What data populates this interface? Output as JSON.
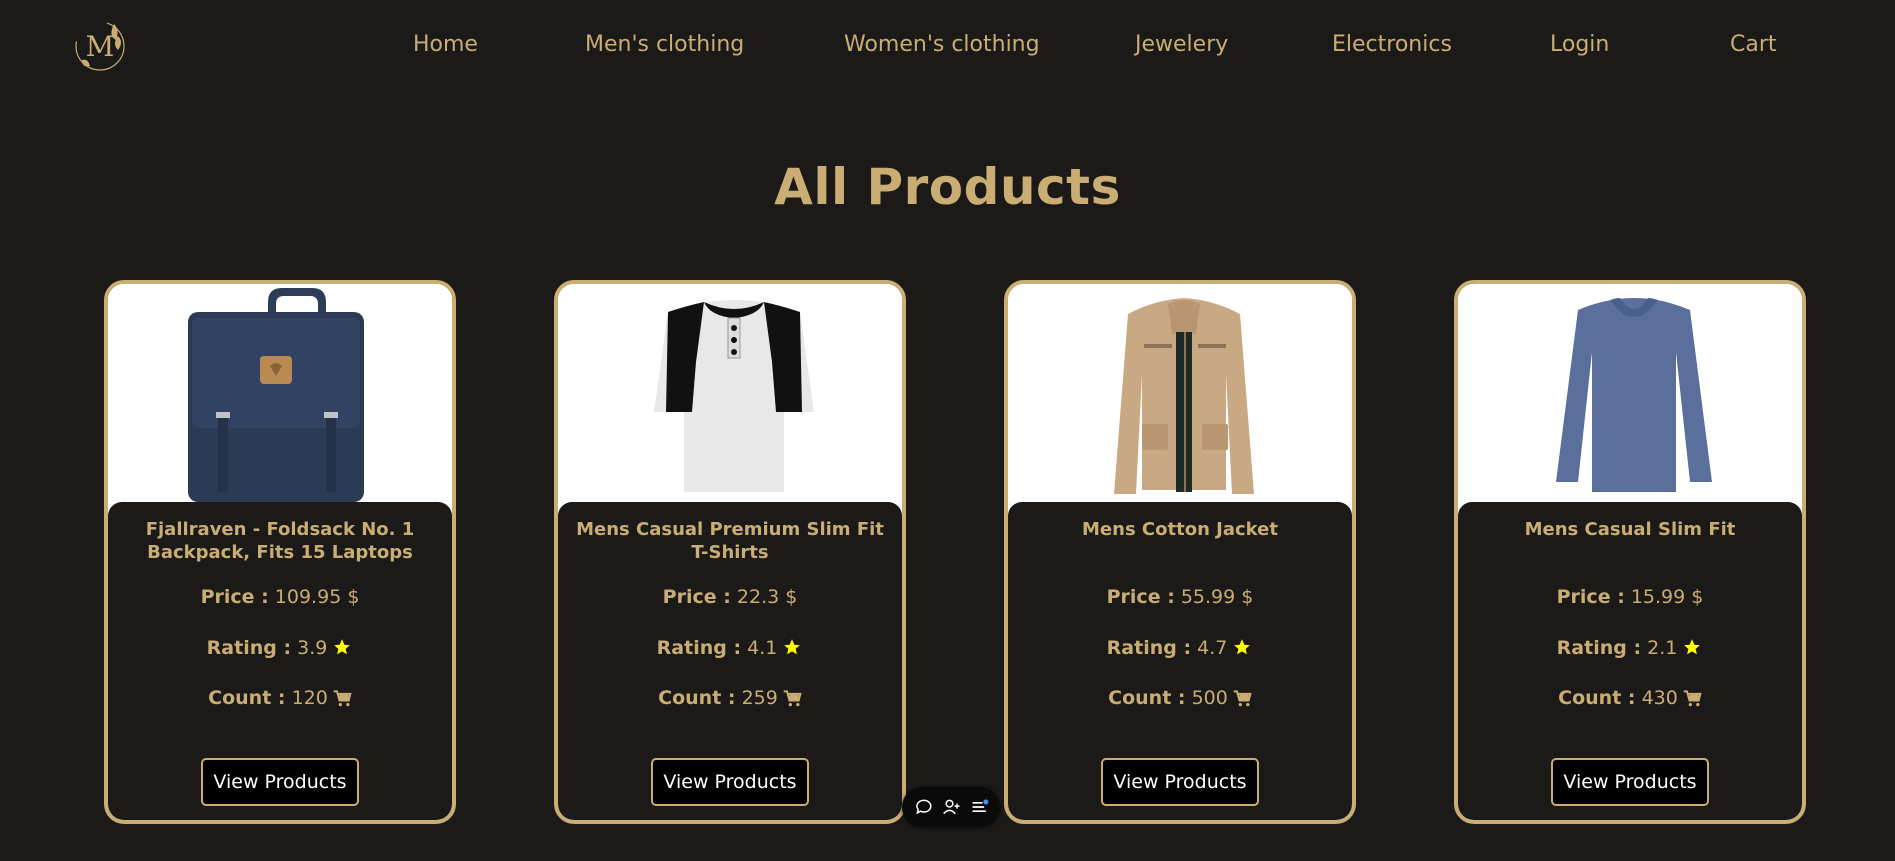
{
  "nav": {
    "logo_letter": "M",
    "links": [
      "Home",
      "Men's clothing",
      "Women's clothing",
      "Jewelery",
      "Electronics",
      "Login",
      "Cart"
    ]
  },
  "page_title": "All Products",
  "labels": {
    "price": "Price :",
    "rating": "Rating :",
    "count": "Count :",
    "button": "View Products"
  },
  "products": [
    {
      "title": "Fjallraven - Foldsack No. 1 Backpack, Fits 15 Laptops",
      "price": "109.95 $",
      "rating": "3.9",
      "count": "120",
      "image": "backpack"
    },
    {
      "title": "Mens Casual Premium Slim Fit T-Shirts",
      "price": "22.3 $",
      "rating": "4.1",
      "count": "259",
      "image": "raglan-tshirt"
    },
    {
      "title": "Mens Cotton Jacket",
      "price": "55.99 $",
      "rating": "4.7",
      "count": "500",
      "image": "jacket"
    },
    {
      "title": "Mens Casual Slim Fit",
      "price": "15.99 $",
      "rating": "2.1",
      "count": "430",
      "image": "longsleeve-shirt"
    }
  ],
  "colors": {
    "background": "#1b1a19",
    "accent": "#c9ad73",
    "star": "#ffff00"
  },
  "toolbar_icons": [
    "chat-icon",
    "add-user-icon",
    "menu-icon"
  ]
}
